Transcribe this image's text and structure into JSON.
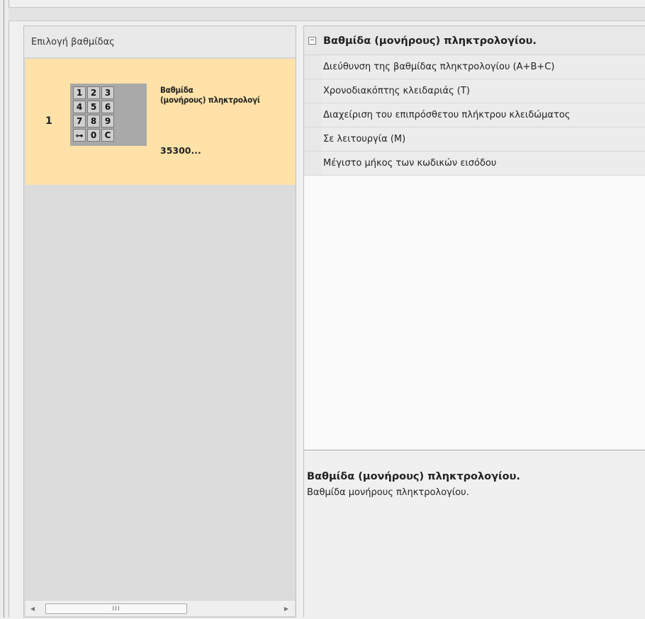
{
  "left_panel": {
    "header": "Επιλογή βαθμίδας",
    "stage": {
      "index": "1",
      "name_line1": "Βαθμίδα",
      "name_line2": "(μονήρους) πληκτρολογί",
      "code": "35300...",
      "keypad": [
        "1",
        "2",
        "3",
        "4",
        "5",
        "6",
        "7",
        "8",
        "9",
        "⊶",
        "0",
        "C"
      ]
    },
    "scrollbar": {
      "thumb_grip": "III"
    }
  },
  "property_grid": {
    "category": {
      "toggle": "−",
      "label": "Βαθμίδα (μονήρους) πληκτρολογίου."
    },
    "properties": [
      "Διεύθυνση της βαθμίδας πληκτρολογίου (A+B+C)",
      "Χρονοδιακόπτης κλειδαριάς (T)",
      "Διαχείριση του επιπρόσθετου πλήκτρου κλειδώματος",
      "Σε λειτουργία (M)",
      "Μέγιστο μήκος των κωδικών εισόδου"
    ]
  },
  "description": {
    "title": "Βαθμίδα (μονήρους) πληκτρολογίου.",
    "text": "Βαθμίδα μονήρους πληκτρολογίου."
  }
}
